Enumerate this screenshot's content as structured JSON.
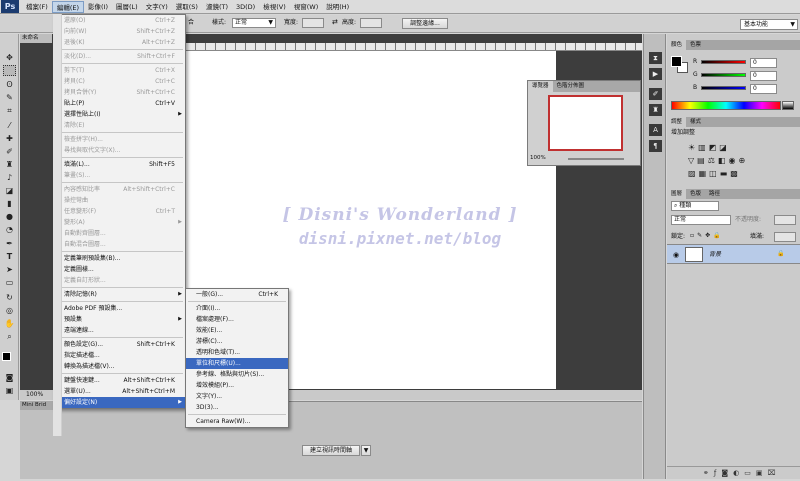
{
  "app": {
    "logo": "Ps"
  },
  "menubar": [
    {
      "label": "檔案(F)",
      "active": false
    },
    {
      "label": "編輯(E)",
      "active": true
    },
    {
      "label": "影像(I)",
      "active": false
    },
    {
      "label": "圖層(L)",
      "active": false
    },
    {
      "label": "文字(Y)",
      "active": false
    },
    {
      "label": "選取(S)",
      "active": false
    },
    {
      "label": "濾鏡(T)",
      "active": false
    },
    {
      "label": "3D(D)",
      "active": false
    },
    {
      "label": "檢視(V)",
      "active": false
    },
    {
      "label": "視窗(W)",
      "active": false
    },
    {
      "label": "說明(H)",
      "active": false
    }
  ],
  "options_bar": {
    "blend_suffix": "合",
    "style_label": "樣式:",
    "style_value": "正常",
    "width_label": "寬度:",
    "height_label": "高度:",
    "refine_edge": "調整邊緣...",
    "workspace": "基本功能"
  },
  "document": {
    "tab": "未命名",
    "zoom": "100%"
  },
  "bottom_panel": {
    "tab": "Mini Brid",
    "create_timeline": "建立視訊時間軸"
  },
  "navigator": {
    "tabs": [
      "導覽器",
      "色階分佈圖"
    ],
    "zoom": "100%"
  },
  "color_panel": {
    "tabs": [
      "顏色",
      "色票"
    ],
    "channels": [
      {
        "name": "R",
        "value": "0"
      },
      {
        "name": "G",
        "value": "0"
      },
      {
        "name": "B",
        "value": "0"
      }
    ]
  },
  "adjustments_panel": {
    "tabs": [
      "調整",
      "樣式"
    ],
    "title": "增加調整"
  },
  "layers_panel": {
    "tabs": [
      "圖層",
      "色版",
      "路徑"
    ],
    "kind_filter": "種類",
    "blend_mode": "正常",
    "opacity_label": "不透明度:",
    "lock_label": "鎖定:",
    "fill_label": "填滿:",
    "layer_name": "背景"
  },
  "edit_menu": [
    {
      "label": "還原(O)",
      "shortcut": "Ctrl+Z",
      "disabled": true
    },
    {
      "label": "向前(W)",
      "shortcut": "Shift+Ctrl+Z",
      "disabled": true
    },
    {
      "label": "退後(K)",
      "shortcut": "Alt+Ctrl+Z",
      "disabled": true
    },
    {
      "sep": true
    },
    {
      "label": "淡化(D)...",
      "shortcut": "Shift+Ctrl+F",
      "disabled": true
    },
    {
      "sep": true
    },
    {
      "label": "剪下(T)",
      "shortcut": "Ctrl+X",
      "disabled": true
    },
    {
      "label": "拷貝(C)",
      "shortcut": "Ctrl+C",
      "disabled": true
    },
    {
      "label": "拷貝合併(Y)",
      "shortcut": "Shift+Ctrl+C",
      "disabled": true
    },
    {
      "label": "貼上(P)",
      "shortcut": "Ctrl+V",
      "disabled": false
    },
    {
      "label": "選擇性貼上(I)",
      "shortcut": "",
      "disabled": false,
      "submenu": true
    },
    {
      "label": "清除(E)",
      "shortcut": "",
      "disabled": true
    },
    {
      "sep": true
    },
    {
      "label": "檢查拼字(H)...",
      "shortcut": "",
      "disabled": true
    },
    {
      "label": "尋找與取代文字(X)...",
      "shortcut": "",
      "disabled": true
    },
    {
      "sep": true
    },
    {
      "label": "填滿(L)...",
      "shortcut": "Shift+F5",
      "disabled": false
    },
    {
      "label": "筆畫(S)...",
      "shortcut": "",
      "disabled": true
    },
    {
      "sep": true
    },
    {
      "label": "內容感知比率",
      "shortcut": "Alt+Shift+Ctrl+C",
      "disabled": true
    },
    {
      "label": "操控彎曲",
      "shortcut": "",
      "disabled": true
    },
    {
      "label": "任意變形(F)",
      "shortcut": "Ctrl+T",
      "disabled": true
    },
    {
      "label": "變形(A)",
      "shortcut": "",
      "disabled": true,
      "submenu": true
    },
    {
      "label": "自動對齊圖層...",
      "shortcut": "",
      "disabled": true
    },
    {
      "label": "自動混合圖層...",
      "shortcut": "",
      "disabled": true
    },
    {
      "sep": true
    },
    {
      "label": "定義筆刷預設集(B)...",
      "shortcut": "",
      "disabled": false
    },
    {
      "label": "定義圖樣...",
      "shortcut": "",
      "disabled": false
    },
    {
      "label": "定義自訂形狀...",
      "shortcut": "",
      "disabled": true
    },
    {
      "sep": true
    },
    {
      "label": "清除記憶(R)",
      "shortcut": "",
      "disabled": false,
      "submenu": true
    },
    {
      "sep": true
    },
    {
      "label": "Adobe PDF 預設集...",
      "shortcut": "",
      "disabled": false
    },
    {
      "label": "預設集",
      "shortcut": "",
      "disabled": false,
      "submenu": true
    },
    {
      "label": "遠端連線...",
      "shortcut": "",
      "disabled": false
    },
    {
      "sep": true
    },
    {
      "label": "顏色設定(G)...",
      "shortcut": "Shift+Ctrl+K",
      "disabled": false
    },
    {
      "label": "指定描述檔...",
      "shortcut": "",
      "disabled": false
    },
    {
      "label": "轉換為描述檔(V)...",
      "shortcut": "",
      "disabled": false
    },
    {
      "sep": true
    },
    {
      "label": "鍵盤快速鍵...",
      "shortcut": "Alt+Shift+Ctrl+K",
      "disabled": false
    },
    {
      "label": "選單(U)...",
      "shortcut": "Alt+Shift+Ctrl+M",
      "disabled": false
    },
    {
      "label": "偏好設定(N)",
      "shortcut": "",
      "disabled": false,
      "submenu": true,
      "highlight": true
    }
  ],
  "prefs_submenu": [
    {
      "label": "一般(G)...",
      "shortcut": "Ctrl+K"
    },
    {
      "sep": true
    },
    {
      "label": "介面(I)...",
      "shortcut": ""
    },
    {
      "label": "檔案處理(F)...",
      "shortcut": ""
    },
    {
      "label": "效能(E)...",
      "shortcut": ""
    },
    {
      "label": "游標(C)...",
      "shortcut": ""
    },
    {
      "label": "透明和色域(T)...",
      "shortcut": ""
    },
    {
      "label": "單位和尺標(U)...",
      "shortcut": "",
      "highlight": true
    },
    {
      "label": "參考線、格點與切片(S)...",
      "shortcut": ""
    },
    {
      "label": "增效模組(P)...",
      "shortcut": ""
    },
    {
      "label": "文字(Y)...",
      "shortcut": ""
    },
    {
      "label": "3D(3)...",
      "shortcut": ""
    },
    {
      "sep": true
    },
    {
      "label": "Camera Raw(W)...",
      "shortcut": ""
    }
  ],
  "watermark": {
    "line1": "[ Disni's Wonderland ]",
    "line2": "disni.pixnet.net/blog"
  }
}
